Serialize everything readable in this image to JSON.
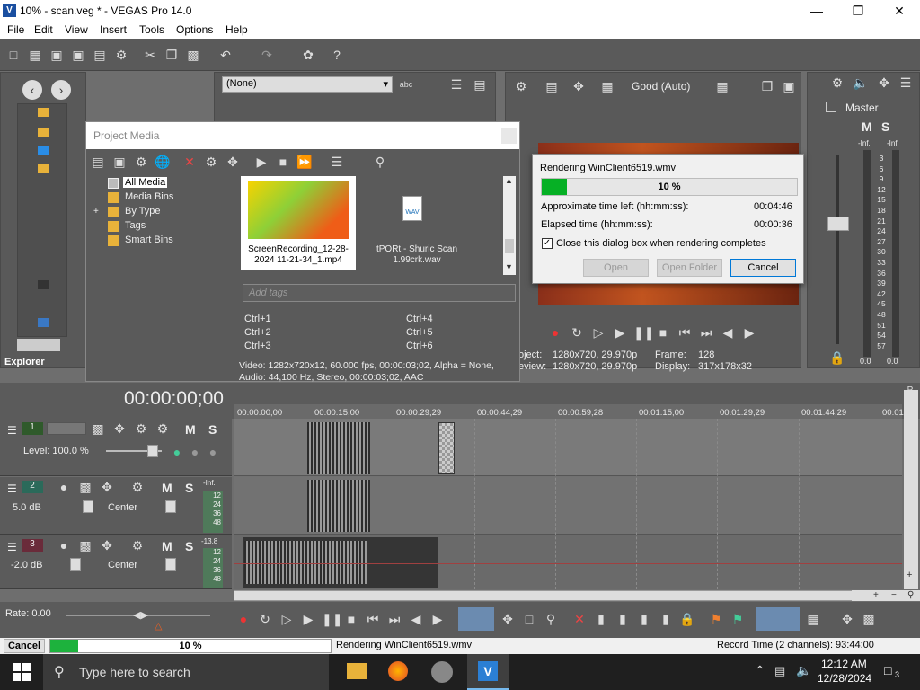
{
  "window": {
    "title": "10% - scan.veg * - VEGAS Pro 14.0"
  },
  "menu": [
    "File",
    "Edit",
    "View",
    "Insert",
    "Tools",
    "Options",
    "Help"
  ],
  "explorer": {
    "tab_label": "Explorer"
  },
  "trimmer": {
    "dropdown_value": "(None)"
  },
  "preview": {
    "quality": "Good (Auto)",
    "project_label": "oject:",
    "project_value": "1280x720, 29.970p",
    "preview_label": "eview:",
    "preview_value": "1280x720, 29.970p",
    "frame_label": "Frame:",
    "frame_value": "128",
    "display_label": "Display:",
    "display_value": "317x178x32"
  },
  "master": {
    "title": "Master",
    "m": "M",
    "s": "S",
    "inf_left": "-Inf.",
    "inf_right": "-Inf.",
    "scale": [
      "3",
      "6",
      "9",
      "12",
      "15",
      "18",
      "21",
      "24",
      "27",
      "30",
      "33",
      "36",
      "39",
      "42",
      "45",
      "48",
      "51",
      "54",
      "57"
    ],
    "bottom_left": "0.0",
    "bottom_right": "0.0"
  },
  "project_media": {
    "title": "Project Media",
    "tree": [
      "All Media",
      "Media Bins",
      "By Type",
      "Tags",
      "Smart Bins"
    ],
    "items": [
      {
        "name": "ScreenRecording_12-28-2024 11-21-34_1.mp4"
      },
      {
        "name": "tPORt - Shuric Scan 1.99crk.wav",
        "badge": "WAV"
      }
    ],
    "tags_placeholder": "Add tags",
    "shortcuts": [
      "Ctrl+1",
      "Ctrl+4",
      "Ctrl+2",
      "Ctrl+5",
      "Ctrl+3",
      "Ctrl+6"
    ],
    "video_info": "Video: 1282x720x12, 60.000 fps, 00:00:03;02, Alpha = None,",
    "audio_info": "Audio: 44,100 Hz, Stereo, 00:00:03;02, AAC"
  },
  "render_dialog": {
    "title": "Rendering WinClient6519.wmv",
    "progress_text": "10 %",
    "progress": 10,
    "time_left_label": "Approximate time left (hh:mm:ss):",
    "time_left": "00:04:46",
    "elapsed_label": "Elapsed time (hh:mm:ss):",
    "elapsed": "00:00:36",
    "close_checkbox_label": "Close this dialog box when rendering completes",
    "open_btn": "Open",
    "open_folder_btn": "Open Folder",
    "cancel_btn": "Cancel"
  },
  "timeline": {
    "timecode": "00:00:00;00",
    "ruler": [
      "00:00:00;00",
      "00:00:15;00",
      "00:00:29;29",
      "00:00:44;29",
      "00:00:59;28",
      "00:01:15;00",
      "00:01:29;29",
      "00:01:44;29",
      "00:01:"
    ],
    "tracks": [
      {
        "num": "1",
        "level": "Level: 100.0 %",
        "m": "M",
        "s": "S"
      },
      {
        "num": "2",
        "vol": "5.0 dB",
        "pan": "Center",
        "m": "M",
        "s": "S",
        "meter_top": "-Inf.",
        "meter": [
          "12",
          "24",
          "36",
          "48"
        ]
      },
      {
        "num": "3",
        "vol": "-2.0 dB",
        "pan": "Center",
        "m": "M",
        "s": "S",
        "meter_top": "-13.8",
        "meter": [
          "12",
          "24",
          "36",
          "48"
        ]
      }
    ],
    "rate": "Rate: 0.00"
  },
  "status": {
    "cancel": "Cancel",
    "progress_text": "10 %",
    "progress": 10,
    "rendering": "Rendering WinClient6519.wmv",
    "record_time": "Record Time (2 channels): 93:44:00"
  },
  "taskbar": {
    "search_placeholder": "Type here to search",
    "time": "12:12 AM",
    "date": "12/28/2024",
    "notif_count": "3"
  },
  "colors": {
    "accent": "#1db23d",
    "panel": "#595959",
    "timeline_bg": "#6e6e6e"
  }
}
